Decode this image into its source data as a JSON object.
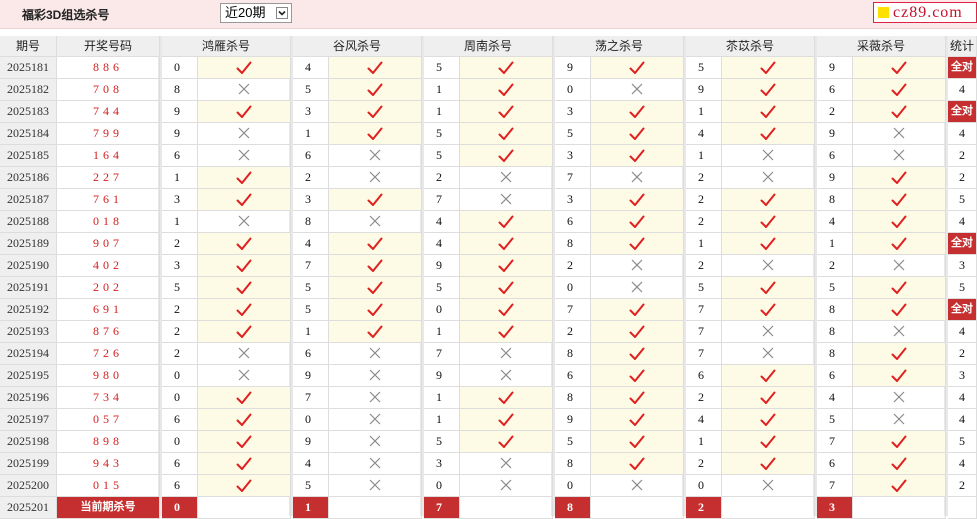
{
  "header": {
    "title": "福彩3D组选杀号",
    "period_select": "近20期",
    "logo": "cz89.com"
  },
  "table": {
    "headers": {
      "period": "期号",
      "draw": "开奖号码",
      "stat": "统计"
    },
    "experts": [
      "鸿雁杀号",
      "谷风杀号",
      "周南杀号",
      "荡之杀号",
      "苶苡杀号",
      "采薇杀号"
    ],
    "rows": [
      {
        "period": "2025181",
        "draw": "886",
        "kills": [
          0,
          4,
          5,
          9,
          5,
          9
        ],
        "hits": [
          true,
          true,
          true,
          true,
          true,
          true
        ],
        "stat": "全对"
      },
      {
        "period": "2025182",
        "draw": "708",
        "kills": [
          8,
          5,
          1,
          0,
          9,
          6
        ],
        "hits": [
          false,
          true,
          true,
          false,
          true,
          true
        ],
        "stat": "4"
      },
      {
        "period": "2025183",
        "draw": "744",
        "kills": [
          9,
          3,
          1,
          3,
          1,
          2
        ],
        "hits": [
          true,
          true,
          true,
          true,
          true,
          true
        ],
        "stat": "全对"
      },
      {
        "period": "2025184",
        "draw": "799",
        "kills": [
          9,
          1,
          5,
          5,
          4,
          9
        ],
        "hits": [
          false,
          true,
          true,
          true,
          true,
          false
        ],
        "stat": "4"
      },
      {
        "period": "2025185",
        "draw": "164",
        "kills": [
          6,
          6,
          5,
          3,
          1,
          6
        ],
        "hits": [
          false,
          false,
          true,
          true,
          false,
          false
        ],
        "stat": "2"
      },
      {
        "period": "2025186",
        "draw": "227",
        "kills": [
          1,
          2,
          2,
          7,
          2,
          9
        ],
        "hits": [
          true,
          false,
          false,
          false,
          false,
          true
        ],
        "stat": "2"
      },
      {
        "period": "2025187",
        "draw": "761",
        "kills": [
          3,
          3,
          7,
          3,
          2,
          8
        ],
        "hits": [
          true,
          true,
          false,
          true,
          true,
          true
        ],
        "stat": "5"
      },
      {
        "period": "2025188",
        "draw": "018",
        "kills": [
          1,
          8,
          4,
          6,
          2,
          4
        ],
        "hits": [
          false,
          false,
          true,
          true,
          true,
          true
        ],
        "stat": "4"
      },
      {
        "period": "2025189",
        "draw": "907",
        "kills": [
          2,
          4,
          4,
          8,
          1,
          1
        ],
        "hits": [
          true,
          true,
          true,
          true,
          true,
          true
        ],
        "stat": "全对"
      },
      {
        "period": "2025190",
        "draw": "402",
        "kills": [
          3,
          7,
          9,
          2,
          2,
          2
        ],
        "hits": [
          true,
          true,
          true,
          false,
          false,
          false
        ],
        "stat": "3"
      },
      {
        "period": "2025191",
        "draw": "202",
        "kills": [
          5,
          5,
          5,
          0,
          5,
          5
        ],
        "hits": [
          true,
          true,
          true,
          false,
          true,
          true
        ],
        "stat": "5"
      },
      {
        "period": "2025192",
        "draw": "691",
        "kills": [
          2,
          5,
          0,
          7,
          7,
          8
        ],
        "hits": [
          true,
          true,
          true,
          true,
          true,
          true
        ],
        "stat": "全对"
      },
      {
        "period": "2025193",
        "draw": "876",
        "kills": [
          2,
          1,
          1,
          2,
          7,
          8
        ],
        "hits": [
          true,
          true,
          true,
          true,
          false,
          false
        ],
        "stat": "4"
      },
      {
        "period": "2025194",
        "draw": "726",
        "kills": [
          2,
          6,
          7,
          8,
          7,
          8
        ],
        "hits": [
          false,
          false,
          false,
          true,
          false,
          true
        ],
        "stat": "2"
      },
      {
        "period": "2025195",
        "draw": "980",
        "kills": [
          0,
          9,
          9,
          6,
          6,
          6
        ],
        "hits": [
          false,
          false,
          false,
          true,
          true,
          true
        ],
        "stat": "3"
      },
      {
        "period": "2025196",
        "draw": "734",
        "kills": [
          0,
          7,
          1,
          8,
          2,
          4
        ],
        "hits": [
          true,
          false,
          true,
          true,
          true,
          false
        ],
        "stat": "4"
      },
      {
        "period": "2025197",
        "draw": "057",
        "kills": [
          6,
          0,
          1,
          9,
          4,
          5
        ],
        "hits": [
          true,
          false,
          true,
          true,
          true,
          false
        ],
        "stat": "4"
      },
      {
        "period": "2025198",
        "draw": "898",
        "kills": [
          0,
          9,
          5,
          5,
          1,
          7
        ],
        "hits": [
          true,
          false,
          true,
          true,
          true,
          true
        ],
        "stat": "5"
      },
      {
        "period": "2025199",
        "draw": "943",
        "kills": [
          6,
          4,
          3,
          8,
          2,
          6
        ],
        "hits": [
          true,
          false,
          false,
          true,
          true,
          true
        ],
        "stat": "4"
      },
      {
        "period": "2025200",
        "draw": "015",
        "kills": [
          6,
          5,
          0,
          0,
          0,
          7
        ],
        "hits": [
          true,
          false,
          false,
          false,
          false,
          true
        ],
        "stat": "2"
      }
    ],
    "current": {
      "period": "2025201",
      "label": "当前期杀号",
      "kills": [
        "0",
        "1",
        "7",
        "8",
        "2",
        "3"
      ]
    }
  },
  "colors": {
    "draw_red": "#d52020",
    "accent_red": "#c62f2f",
    "check": "#e02020",
    "cross": "#8a8a8a",
    "hit_bg": "#fdfbe5"
  },
  "icons": {
    "hit": "check-icon",
    "miss": "cross-icon",
    "dropdown": "chevron-down-icon",
    "logo_square": "yellow-square-icon"
  }
}
